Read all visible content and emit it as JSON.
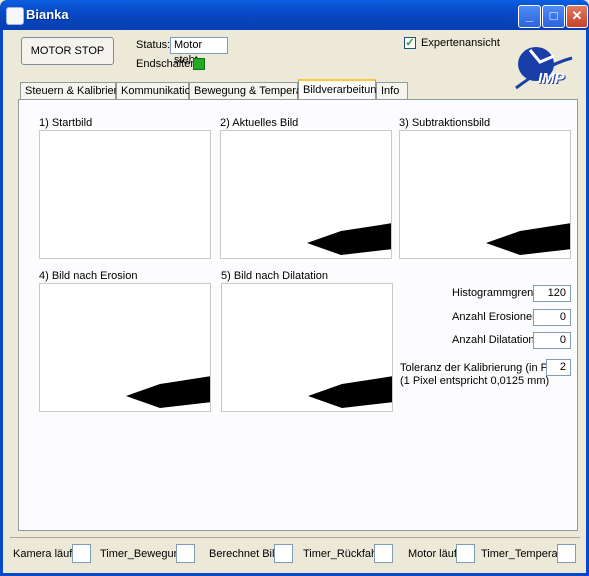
{
  "window": {
    "title": "Bianka"
  },
  "header": {
    "motor_stop_label": "MOTOR STOP",
    "status_label": "Status:",
    "status_value": "Motor steht",
    "endschalter_label": "Endschalter",
    "endschalter_color": "#22aa22",
    "expert_label": "Expertenansicht",
    "expert_checked": true,
    "logo_text": "IMP"
  },
  "tabs": [
    {
      "label": "Steuern & Kalibrieren"
    },
    {
      "label": "Kommunikation"
    },
    {
      "label": "Bewegung & Temperatur"
    },
    {
      "label": "Bildverarbeitung"
    },
    {
      "label": "Info"
    }
  ],
  "active_tab": "Bildverarbeitung",
  "images": [
    {
      "label": "1) Startbild"
    },
    {
      "label": "2) Aktuelles Bild"
    },
    {
      "label": "3) Subtraktionsbild"
    },
    {
      "label": "4) Bild nach Erosion"
    },
    {
      "label": "5) Bild nach Dilatation"
    }
  ],
  "settings": {
    "histogram_label": "Histogrammgrenze",
    "histogram_value": "120",
    "erosion_label": "Anzahl Erosionen",
    "erosion_value": "0",
    "dilation_label": "Anzahl Dilatationen",
    "dilation_value": "0",
    "tolerance_label": "Toleranz der Kalibrierung (in Pixel)",
    "tolerance_value": "2",
    "tolerance_note": "(1 Pixel entspricht 0,0125 mm)"
  },
  "statusbar": [
    {
      "label": "Kamera läuft"
    },
    {
      "label": "Timer_Bewegung"
    },
    {
      "label": "Berechnet Bild"
    },
    {
      "label": "Timer_Rückfahrt"
    },
    {
      "label": "Motor läuft"
    },
    {
      "label": "Timer_Temperatur"
    }
  ]
}
